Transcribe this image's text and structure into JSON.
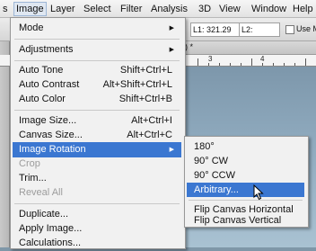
{
  "menubar": {
    "items": [
      {
        "label": "s"
      },
      {
        "label": "Image"
      },
      {
        "label": "Layer"
      },
      {
        "label": "Select"
      },
      {
        "label": "Filter"
      },
      {
        "label": "Analysis"
      },
      {
        "label": "3D"
      },
      {
        "label": "View"
      },
      {
        "label": "Window"
      },
      {
        "label": "Help"
      }
    ]
  },
  "optbar": {
    "l1_value": "L1: 321.29",
    "l2_label": "L2:",
    "use_label": "Use M"
  },
  "doc": {
    "tab_marker": ") *",
    "left_marker": "s_",
    "ruler_numbers": [
      "3",
      "4"
    ]
  },
  "image_menu": {
    "items": [
      {
        "label": "Mode",
        "shortcut": "",
        "arrow": "▶"
      },
      {
        "label": "Adjustments",
        "shortcut": "",
        "arrow": "▶"
      },
      {
        "label": "Auto Tone",
        "shortcut": "Shift+Ctrl+L"
      },
      {
        "label": "Auto Contrast",
        "shortcut": "Alt+Shift+Ctrl+L"
      },
      {
        "label": "Auto Color",
        "shortcut": "Shift+Ctrl+B"
      },
      {
        "label": "Image Size...",
        "shortcut": "Alt+Ctrl+I"
      },
      {
        "label": "Canvas Size...",
        "shortcut": "Alt+Ctrl+C"
      },
      {
        "label": "Image Rotation",
        "shortcut": "",
        "arrow": "▶"
      },
      {
        "label": "Crop",
        "shortcut": ""
      },
      {
        "label": "Trim...",
        "shortcut": ""
      },
      {
        "label": "Reveal All",
        "shortcut": ""
      },
      {
        "label": "Duplicate...",
        "shortcut": ""
      },
      {
        "label": "Apply Image...",
        "shortcut": ""
      },
      {
        "label": "Calculations...",
        "shortcut": ""
      }
    ]
  },
  "rotation_submenu": {
    "items": [
      {
        "label": "180°"
      },
      {
        "label": "90° CW"
      },
      {
        "label": "90° CCW"
      },
      {
        "label": "Arbitrary..."
      },
      {
        "label": "Flip Canvas Horizontal"
      },
      {
        "label": "Flip Canvas Vertical"
      }
    ]
  },
  "colors": {
    "highlight": "#3b77d1",
    "menu_bg": "#f1f1f1",
    "disabled_text": "#9c9c9c"
  }
}
